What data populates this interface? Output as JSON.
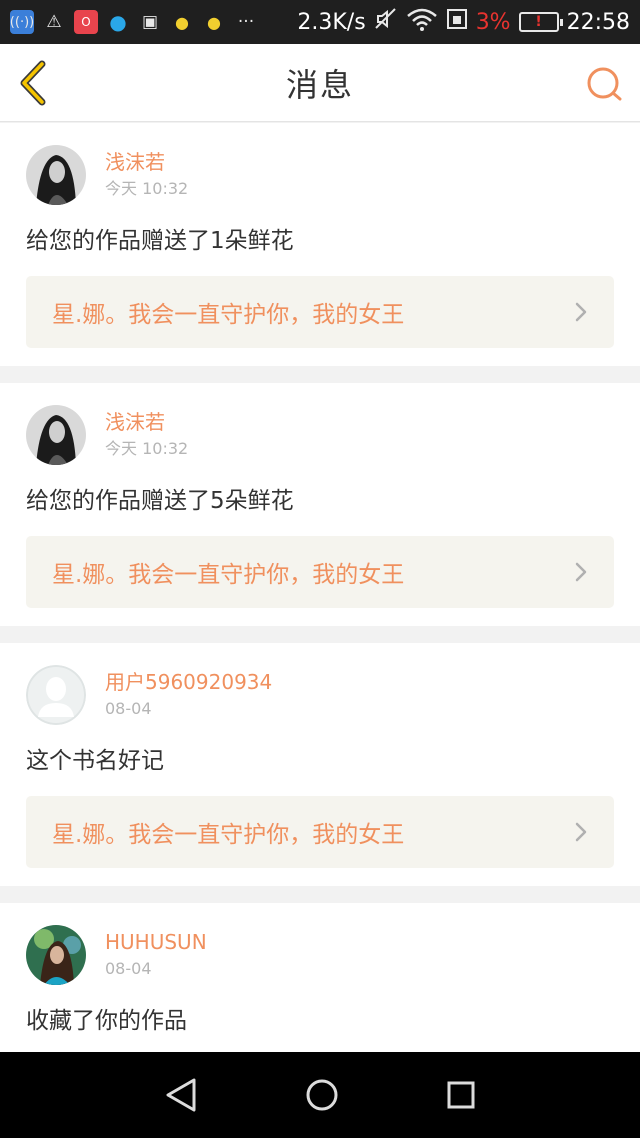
{
  "status_bar": {
    "net_speed": "2.3K/s",
    "battery_pct": "3%",
    "time": "22:58",
    "dots": "···",
    "icons": [
      "wifi-app-icon",
      "warning-icon",
      "opera-icon",
      "qq-icon",
      "image-icon",
      "bulb-icon",
      "bulb-icon",
      "mute-icon",
      "wifi-icon",
      "sim-icon",
      "battery-low-icon"
    ]
  },
  "header": {
    "title": "消息"
  },
  "messages": [
    {
      "name": "浅沫若",
      "time": "今天 10:32",
      "text": "给您的作品赠送了1朵鲜花",
      "book": "星.娜。我会一直守护你，我的女王"
    },
    {
      "name": "浅沫若",
      "time": "今天 10:32",
      "text": "给您的作品赠送了5朵鲜花",
      "book": "星.娜。我会一直守护你，我的女王"
    },
    {
      "name": "用户5960920934",
      "time": "08-04",
      "text": "这个书名好记",
      "book": "星.娜。我会一直守护你，我的女王"
    },
    {
      "name": "HUHUSUN",
      "time": "08-04",
      "text": "收藏了你的作品"
    }
  ],
  "colors": {
    "accent": "#f0905e",
    "back_arrow": "#f5c400"
  }
}
